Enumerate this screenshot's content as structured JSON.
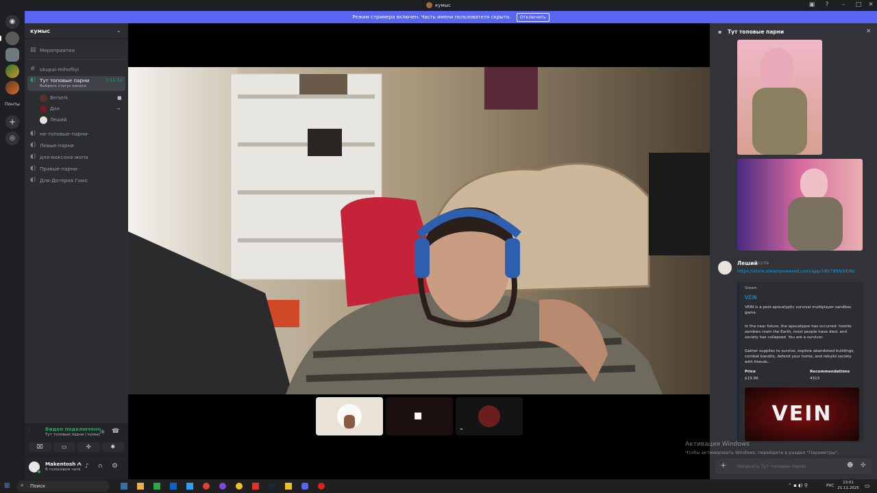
{
  "window": {
    "title": "кумыс"
  },
  "banner": {
    "text": "Режим стримера включен. Часть имени пользователя скрыта.",
    "button": "Отключить"
  },
  "servers": {
    "folder_label": "Понты"
  },
  "sidebar": {
    "server_name": "кумыс",
    "events": "Мероприятия",
    "text_channel": "okupai-mihofilyi",
    "voice_active": {
      "name": "Тут топовые парни",
      "timer": "3:11:12",
      "status_hint": "Выбрать статус канала"
    },
    "voice_users": [
      {
        "name": "Berserk"
      },
      {
        "name": "Дон"
      },
      {
        "name": "Леший"
      }
    ],
    "voice_channels": [
      {
        "name": "не-топовые-парни-"
      },
      {
        "name": "Левые-парни"
      },
      {
        "name": "для-максона-жопа"
      },
      {
        "name": "Правые-парни-"
      },
      {
        "name": "Для-Дотеров Гомо"
      }
    ]
  },
  "voice_connection": {
    "status": "Видео подключено",
    "channel": "Тут топовые парни / кумыс"
  },
  "user": {
    "name": "Makentosh ₼",
    "status": "В голосовом чате"
  },
  "chat": {
    "header": "Тут топовые парни",
    "message": {
      "author": "Леший",
      "time": "12:59",
      "link": "https://store.steampowered.com/app/1857950/VEIN/"
    },
    "embed": {
      "provider": "Steam",
      "title": "VEIN",
      "desc1": "VEIN is a post-apocalyptic survival multiplayer sandbox game.",
      "desc2": "In the near future, the apocalypse has occurred: hostile zombies roam the Earth, most people have died, and society has collapsed. You are a survivor.",
      "desc3": "Gather supplies to survive, explore abandoned buildings, combat bandits, defend your home, and rebuild society with friends...",
      "price_label": "Price",
      "price_value": "$19.99",
      "rec_label": "Recommendations",
      "rec_value": "4313",
      "image_text": "VEIN"
    },
    "input_placeholder": "Написать Тут топовые парни"
  },
  "watermark": {
    "title": "Активация Windows",
    "sub": "Чтобы активировать Windows, перейдите в раздел \"Параметры\"."
  },
  "taskbar": {
    "search": "Поиск",
    "lang": "РУС",
    "time": "13:01",
    "date": "21.11.2025"
  }
}
